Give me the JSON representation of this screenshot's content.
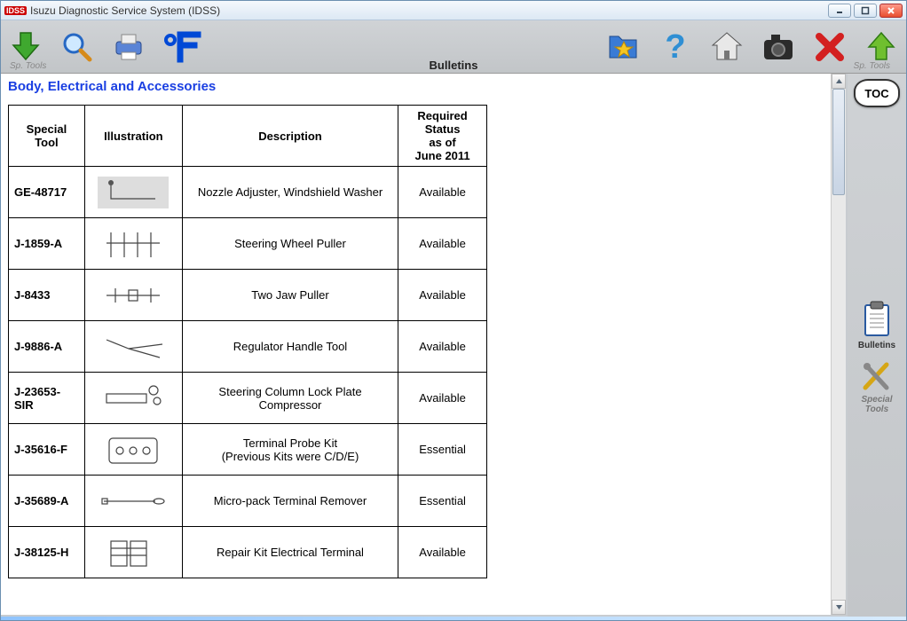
{
  "window": {
    "badge": "IDSS",
    "title": "Isuzu Diagnostic Service System (IDSS)"
  },
  "toolbar": {
    "sp_tools_left": "Sp. Tools",
    "sp_tools_right": "Sp. Tools",
    "heading": "Bulletins"
  },
  "section_title": "Body, Electrical and Accessories",
  "table": {
    "headers": {
      "tool": "Special Tool",
      "illustration": "Illustration",
      "description": "Description",
      "status": "Required\nStatus\nas of\nJune 2011"
    },
    "rows": [
      {
        "id": "GE-48717",
        "desc": "Nozzle Adjuster, Windshield Washer",
        "status": "Available"
      },
      {
        "id": "J-1859-A",
        "desc": "Steering Wheel Puller",
        "status": "Available"
      },
      {
        "id": "J-8433",
        "desc": "Two Jaw Puller",
        "status": "Available"
      },
      {
        "id": "J-9886-A",
        "desc": "Regulator Handle Tool",
        "status": "Available"
      },
      {
        "id": "J-23653-SIR",
        "desc": "Steering Column Lock Plate\nCompressor",
        "status": "Available"
      },
      {
        "id": "J-35616-F",
        "desc": "Terminal Probe Kit\n(Previous Kits were C/D/E)",
        "status": "Essential"
      },
      {
        "id": "J-35689-A",
        "desc": "Micro-pack Terminal Remover",
        "status": "Essential"
      },
      {
        "id": "J-38125-H",
        "desc": "Repair Kit Electrical Terminal",
        "status": "Available"
      }
    ]
  },
  "rail": {
    "toc": "TOC",
    "bulletins": "Bulletins",
    "special_tools": "Special\nTools"
  }
}
